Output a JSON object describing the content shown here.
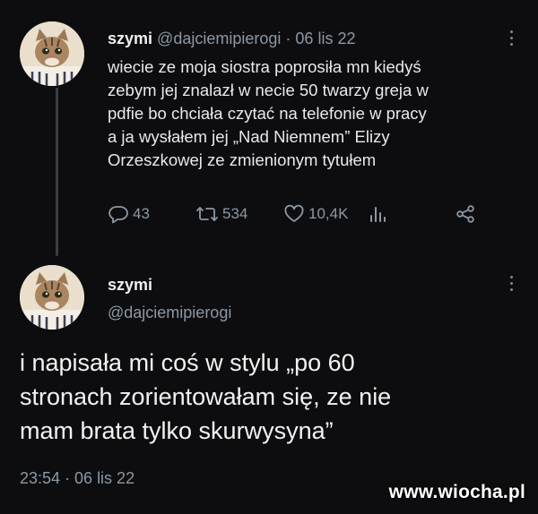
{
  "tweet1": {
    "author_name": "szymi",
    "handle": "@dajciemipierogi",
    "separator": "·",
    "date": "06 lis 22",
    "avatar_icon": "cat-avatar-icon",
    "text_lines": [
      "wiecie ze moja siostra poprosiła mn kiedyś",
      "zebym jej znalazł w necie 50 twarzy greja w",
      "pdfie bo chciała czytać na telefonie w pracy",
      "a ja wysłałem jej „Nad Niemnem” Elizy",
      "Orzeszkowej ze zmienionym tytułem"
    ],
    "actions": {
      "replies": "43",
      "retweets": "534",
      "likes": "10,4K",
      "icons": [
        "reply-icon",
        "retweet-icon",
        "like-icon",
        "analytics-icon",
        "share-icon"
      ]
    }
  },
  "tweet2": {
    "author_name": "szymi",
    "handle": "@dajciemipierogi",
    "avatar_icon": "cat-avatar-icon",
    "text_lines": [
      "i napisała mi coś w stylu „po 60",
      "stronach zorientowałam się, ze nie",
      "mam brata tylko skurwysyna”"
    ],
    "timestamp": "23:54 · 06 lis 22"
  },
  "watermark": "www.wiocha.pl",
  "colors": {
    "background": "#0d0d0f",
    "text": "#e7e9ea",
    "muted": "#8b98a5",
    "thread_line": "#3a3f44"
  }
}
